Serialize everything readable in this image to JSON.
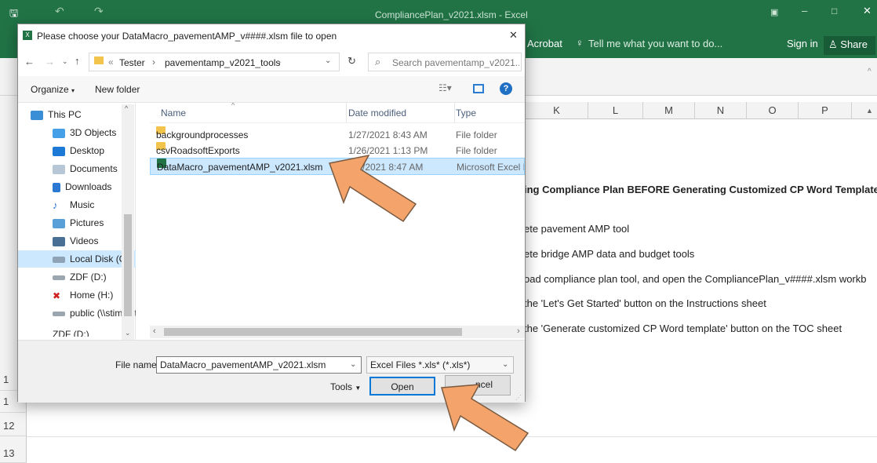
{
  "excel": {
    "window_title": "CompliancePlan_v2021.xlsm - Excel",
    "ribbon": {
      "acrobat": "Acrobat",
      "tell_me": "Tell me what you want to do...",
      "sign_in": "Sign in",
      "share": "Share"
    },
    "columns": [
      "K",
      "L",
      "M",
      "N",
      "O",
      "P"
    ],
    "rows": [
      "1",
      "1",
      "12",
      "13"
    ],
    "sheet_lines": [
      "ing Compliance Plan BEFORE Generating Customized CP Word Template",
      "ete pavement AMP tool",
      "ete bridge AMP data and budget tools",
      "oad compliance plan tool, and open the CompliancePlan_v####.xlsm workb",
      "the 'Let's Get Started' button on the Instructions sheet",
      "the 'Generate customized CP Word template' button on the TOC sheet"
    ]
  },
  "dialog": {
    "title": "Please choose your DataMacro_pavementAMP_v####.xlsm file to open",
    "breadcrumb": [
      "Tester",
      "pavementamp_v2021_tools"
    ],
    "search_placeholder": "Search pavementamp_v2021...",
    "organize": "Organize",
    "new_folder": "New folder",
    "nav_items": [
      "This PC",
      "3D Objects",
      "Desktop",
      "Documents",
      "Downloads",
      "Music",
      "Pictures",
      "Videos",
      "Local Disk (C:)",
      "ZDF (D:)",
      "Home (H:)",
      "public (\\\\stimpy.t",
      "ZDF (D:)"
    ],
    "columns": {
      "name": "Name",
      "date": "Date modified",
      "type": "Type"
    },
    "files": [
      {
        "name": "backgroundprocesses",
        "date": "1/27/2021 8:43 AM",
        "type": "File folder",
        "kind": "folder"
      },
      {
        "name": "csvRoadsoftExports",
        "date": "1/26/2021 1:13 PM",
        "type": "File folder",
        "kind": "folder"
      },
      {
        "name": "DataMacro_pavementAMP_v2021.xlsm",
        "date": "/2021 8:47 AM",
        "type": "Microsoft Excel M",
        "kind": "excel"
      }
    ],
    "file_name_label": "File name:",
    "file_name_value": "DataMacro_pavementAMP_v2021.xlsm",
    "filter_value": "Excel Files *.xls* (*.xls*)",
    "tools_label": "Tools",
    "open_label": "Open",
    "cancel_label": "ncel"
  },
  "colors": {
    "excel_green": "#217346",
    "selection": "#cce8ff",
    "arrow": "#f4a46a"
  }
}
